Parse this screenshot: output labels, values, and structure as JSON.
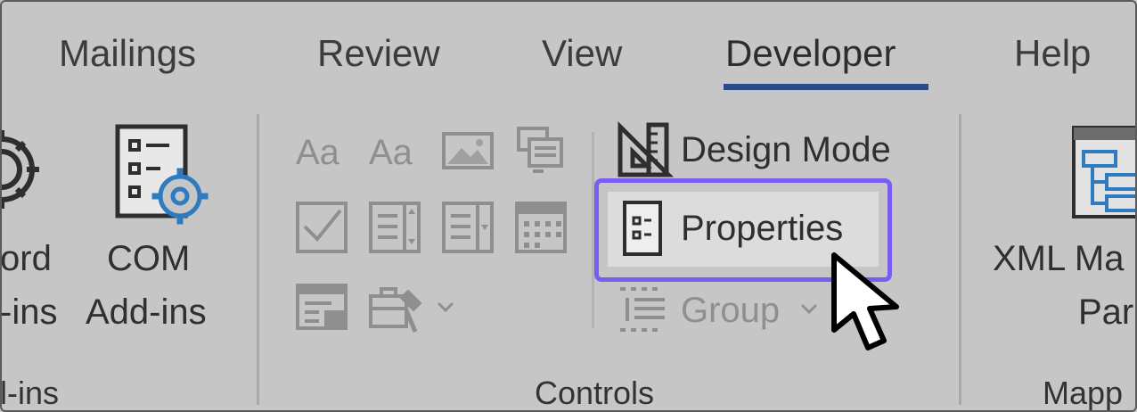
{
  "ribbon": {
    "tabs": [
      {
        "label": "Mailings",
        "active": false
      },
      {
        "label": "Review",
        "active": false
      },
      {
        "label": "View",
        "active": false
      },
      {
        "label": "Developer",
        "active": true
      },
      {
        "label": "Help",
        "active": false
      }
    ],
    "accent_color": "#2b4a8c",
    "highlight_color": "#7b5cf2"
  },
  "addins_group": {
    "word_addins_label_line1": "ord",
    "word_addins_label_line2": "-ins",
    "com_addins_label_line1": "COM",
    "com_addins_label_line2": "Add-ins",
    "group_label": "l-ins"
  },
  "controls_group": {
    "design_mode_label": "Design Mode",
    "properties_label": "Properties",
    "group_button_label": "Group",
    "group_label": "Controls"
  },
  "mapping_group": {
    "xml_mapping_label_line1": "XML Ma",
    "xml_mapping_label_line2": "Par",
    "group_label": "Mapp"
  }
}
